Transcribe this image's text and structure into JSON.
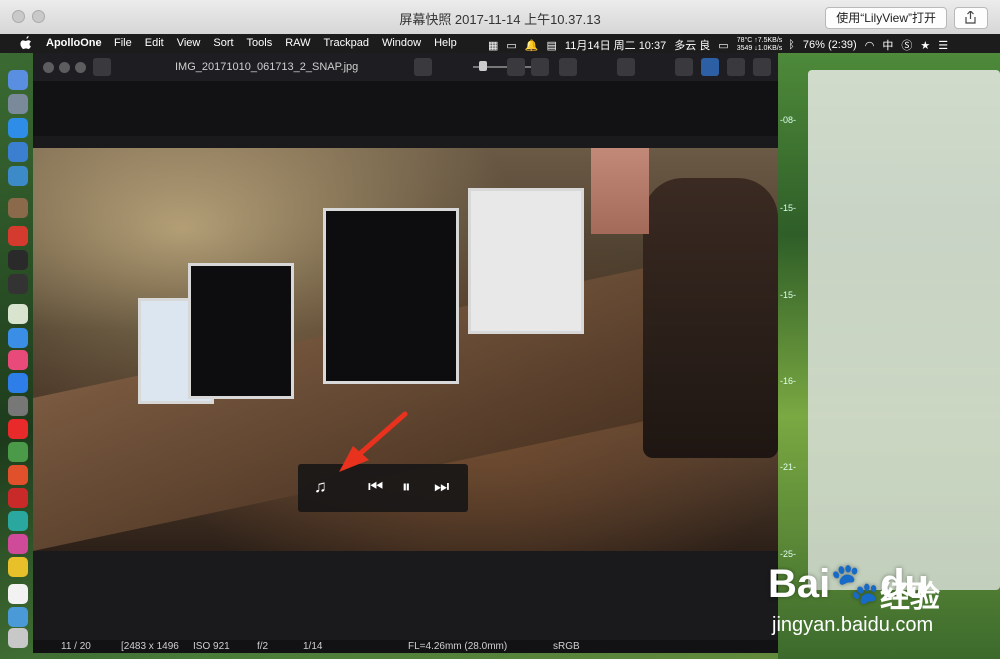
{
  "outer_window": {
    "title": "屏幕快照 2017-11-14 上午10.37.13",
    "open_button": "使用“LilyView”打开"
  },
  "menubar": {
    "app_name": "ApolloOne",
    "items": [
      "File",
      "Edit",
      "View",
      "Sort",
      "Tools",
      "RAW",
      "Trackpad",
      "Window",
      "Help"
    ],
    "net_up": "78°C ↑7.5KB/s",
    "net_down": "3549 ↓1.0KB/s",
    "datetime": "11月14日 周二 10:37",
    "weather": "多云 良",
    "battery": "76% (2:39)",
    "input_method": "中"
  },
  "app": {
    "file_name": "IMG_20171010_061713_2_SNAP.jpg",
    "zoom_level": 0.15
  },
  "ruler_marks": [
    "-08-",
    "-15-",
    "-15-",
    "-16-",
    "-21-",
    "-25-"
  ],
  "status_bar": {
    "index": "11 / 20",
    "resolution": "[2483 x 1496",
    "iso": "ISO 921",
    "aperture": "f/2",
    "shutter": "1/14",
    "focal": "FL=4.26mm (28.0mm)",
    "color_space": "sRGB"
  },
  "player": {
    "music_icon": "♫",
    "prev_icon": "⏮",
    "pause_icon": "⏸",
    "next_icon": "⏭"
  },
  "watermark": {
    "brand": "Bai",
    "brand2": "du",
    "cn": "经验",
    "url": "jingyan.baidu.com"
  },
  "colors": {
    "accent": "#2d5fa5",
    "arrow": "#e8321e"
  }
}
